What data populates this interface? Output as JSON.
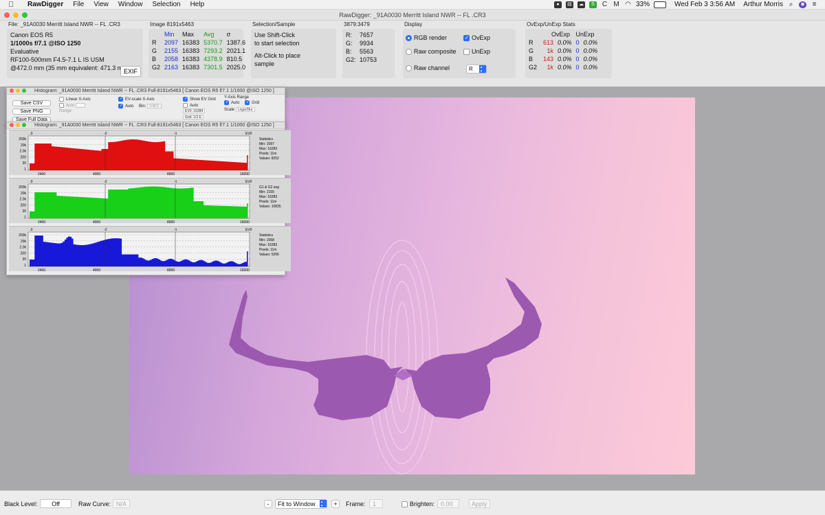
{
  "menubar": {
    "app_name": "RawDigger",
    "menus": [
      "File",
      "View",
      "Window",
      "Selection",
      "Help"
    ],
    "battery": "33%",
    "datetime": "Wed Feb 3  3:56 AM",
    "user": "Arthur Morris"
  },
  "window": {
    "title": "RawDigger: _91A0030  Merritt Island NWR -- FL .CR3"
  },
  "file_panel": {
    "caption": "File: _91A0030  Merritt Island NWR -- FL .CR3",
    "camera": "Canon EOS R5",
    "exposure": "1/1000s f/7.1 @ISO 1250",
    "metering": "Evaluative",
    "lens": "RF100-500mm F4.5-7.1 L IS USM",
    "focal": "@472.0 mm (35 mm equivalent: 471.3 m",
    "exif_button": "EXIF"
  },
  "image_panel": {
    "caption": "Image 8191x5463",
    "headers": [
      "",
      "Min",
      "Max",
      "Avg",
      "σ"
    ],
    "rows": [
      {
        "ch": "R",
        "min": "2097",
        "max": "16383",
        "avg": "5370.7",
        "sd": "1387.6"
      },
      {
        "ch": "G",
        "min": "2155",
        "max": "16383",
        "avg": "7293.2",
        "sd": "2021.1"
      },
      {
        "ch": "B",
        "min": "2058",
        "max": "16383",
        "avg": "4378.9",
        "sd": "810.5"
      },
      {
        "ch": "G2",
        "min": "2163",
        "max": "16383",
        "avg": "7301.5",
        "sd": "2025.0"
      }
    ]
  },
  "selection_panel": {
    "caption": "Selection/Sample",
    "line1": "Use Shift-Click",
    "line2": "to start selection",
    "line3": "Alt-Click to place",
    "line4": "sample"
  },
  "sample_panel": {
    "caption": "3879:3479",
    "rows": [
      {
        "ch": "R:",
        "val": "7657"
      },
      {
        "ch": "G:",
        "val": "9934"
      },
      {
        "ch": "B:",
        "val": "5563"
      },
      {
        "ch": "G2:",
        "val": "10753"
      }
    ]
  },
  "display_panel": {
    "caption": "Display",
    "rgb_render": "RGB render",
    "raw_composite": "Raw composite",
    "raw_channel": "Raw channel",
    "ovexp": "OvExp",
    "unexp": "UnExp",
    "channel_value": "R"
  },
  "ovexp_panel": {
    "caption": "OvExp/UnExp Stats",
    "headers": [
      "",
      "OvExp",
      "",
      "UnExp",
      ""
    ],
    "rows": [
      {
        "ch": "R",
        "ov": "613",
        "ovp": "0.0%",
        "un": "0",
        "unp": "0.0%"
      },
      {
        "ch": "G",
        "ov": "1k",
        "ovp": "0.0%",
        "un": "0",
        "unp": "0.0%"
      },
      {
        "ch": "B",
        "ov": "143",
        "ovp": "0.0%",
        "un": "0",
        "unp": "0.0%"
      },
      {
        "ch": "G2",
        "ov": "1k",
        "ovp": "0.0%",
        "un": "0",
        "unp": "0.0%"
      }
    ]
  },
  "histogram_back": {
    "title": "Histogram: _91A0030  Merritt Island NWR -- FL .CR3 Full-8191x5463 [ Canon EOS R5 f/7.1 1/1000 @ISO 1250 ]",
    "save_csv": "Save CSV",
    "save_png": "Save PNG",
    "save_full": "Save Full Data",
    "linear_x": "Linear X-Axis",
    "auto": "Auto",
    "range": "Range:",
    "ev_scale": "EV-scale X-Axis",
    "bin": "Bin:",
    "bin_value": "1/48 E",
    "show_ev_grid": "Show EV Grid",
    "ev0": "EV0: 16384",
    "grid_step": "Grid: 1/3 E",
    "y_range": "Y-Axis Range",
    "grid": "Grid",
    "scale": "Scale",
    "scale_value": "LogarSfur"
  },
  "histogram_front": {
    "title": "Histogram: _91A0030  Merritt Island NWR -- FL .CR3 Full-8191x5463 [ Canon EOS R5 f/7.1 1/1000 @ISO 1250 ]",
    "panels": [
      {
        "color": "#e01010",
        "stats": [
          "Statistics",
          "Min: 2097",
          "Max: 16383",
          "Pixels: 11m",
          "Values: 8252"
        ]
      },
      {
        "color": "#18d018",
        "stats": [
          "G1 & G2 avg",
          "Min: 2155",
          "Max: 16383",
          "Pixels: 11m",
          "Values: 10835"
        ]
      },
      {
        "color": "#1818d8",
        "stats": [
          "Statistics",
          "Min: 2058",
          "Max: 16383",
          "Pixels: 11m",
          "Values: 5206"
        ]
      }
    ],
    "ev_labels": [
      "-3",
      "-2",
      "-1",
      "EV0"
    ],
    "x_labels": [
      "2400",
      "4000",
      "8000",
      "16000"
    ],
    "y_labels": [
      "200k",
      "20k",
      "2.0k",
      "200",
      "20",
      "1"
    ]
  },
  "bottombar": {
    "black_level_label": "Black Level:",
    "black_level_value": "Off",
    "raw_curve_label": "Raw Curve:",
    "raw_curve_value": "N/A",
    "zoom_minus": "-",
    "zoom_value": "Fit to Window",
    "zoom_plus": "+",
    "frame_label": "Frame:",
    "frame_value": "1",
    "brighten_label": "Brighten:",
    "brighten_value": "0.00",
    "apply": "Apply"
  },
  "colors": {
    "accent": "#2a6ff5",
    "photo_left": "#b58dcf",
    "photo_right": "#fccad8",
    "bird": "#9b59b0"
  }
}
